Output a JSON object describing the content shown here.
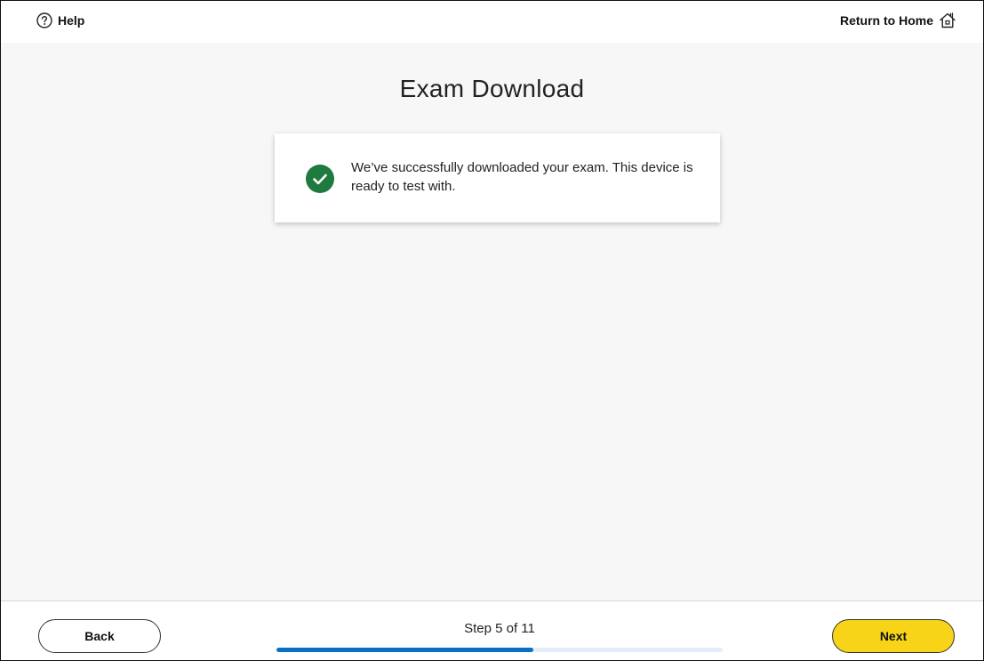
{
  "header": {
    "help_label": "Help",
    "home_label": "Return to Home"
  },
  "main": {
    "title": "Exam Download",
    "message": "We’ve successfully downloaded your exam. This device is ready to test with."
  },
  "footer": {
    "back_label": "Back",
    "next_label": "Next",
    "step_text": "Step 5 of 11",
    "progress_fraction": 0.5755
  },
  "colors": {
    "success": "#1f7a3f",
    "progress": "#0a6fc2",
    "next_button": "#f7d417"
  },
  "icons": {
    "help": "help-circle-icon",
    "home": "home-icon",
    "success": "check-circle-icon"
  }
}
